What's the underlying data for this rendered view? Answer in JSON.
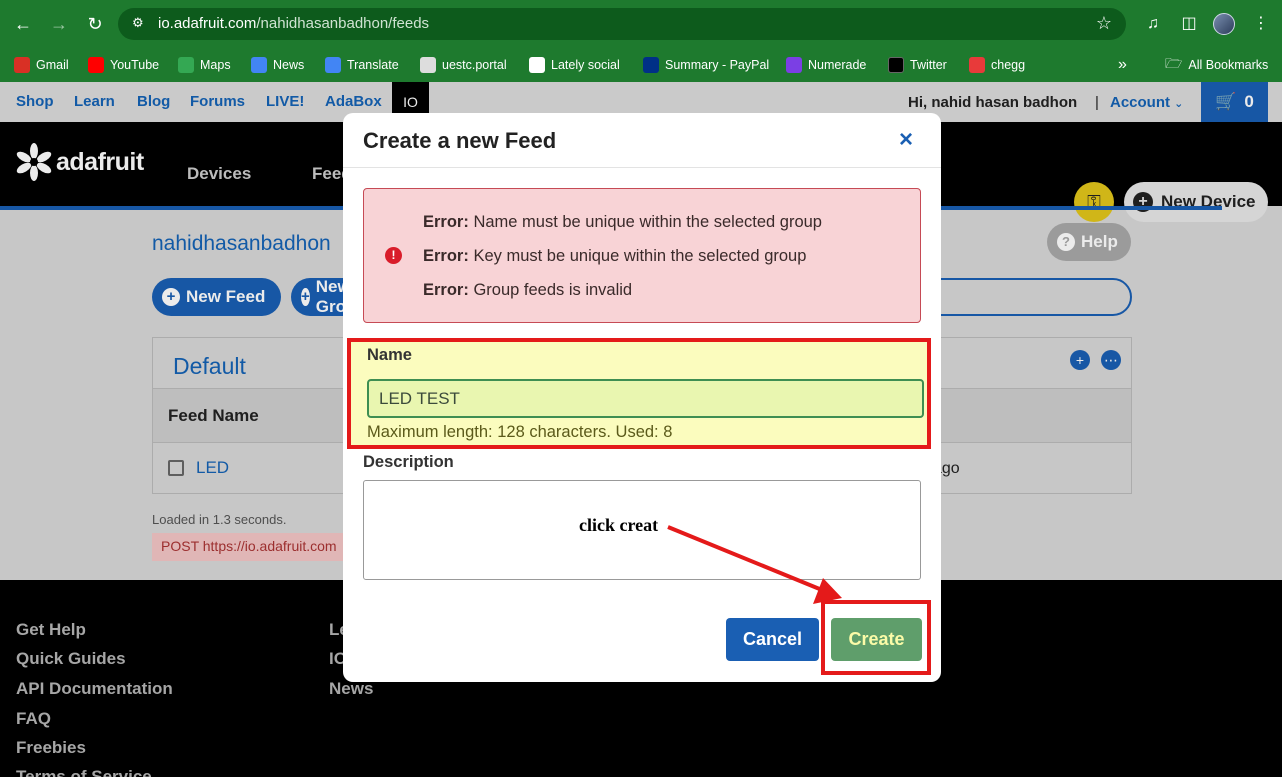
{
  "browser": {
    "url_domain": "io.adafruit.com",
    "url_path": "/nahidhasanbadhon/feeds",
    "more_label": "»",
    "all_bookmarks": "All Bookmarks",
    "bookmarks": [
      {
        "label": "Gmail",
        "color": "#d93025"
      },
      {
        "label": "YouTube",
        "color": "#ff0000"
      },
      {
        "label": "Maps",
        "color": "#34a853"
      },
      {
        "label": "News",
        "color": "#4285f4"
      },
      {
        "label": "Translate",
        "color": "#4285f4"
      },
      {
        "label": "uestc.portal",
        "color": "#dddddd"
      },
      {
        "label": "Lately social",
        "color": "#ffffff"
      },
      {
        "label": "Summary - PayPal",
        "color": "#003087"
      },
      {
        "label": "Numerade",
        "color": "#7b3fe4"
      },
      {
        "label": "Twitter",
        "color": "#000000"
      },
      {
        "label": "chegg",
        "color": "#e83a3a"
      }
    ]
  },
  "topbar": {
    "links": [
      "Shop",
      "Learn",
      "Blog",
      "Forums",
      "LIVE!",
      "AdaBox"
    ],
    "io": "IO",
    "greeting": "Hi, nahid hasan badhon",
    "separator": "|",
    "account": "Account",
    "cart_count": "0"
  },
  "mainnav": {
    "logo": "adafruit",
    "devices": "Devices",
    "feeds": "Feeds",
    "new_device": "New Device"
  },
  "content": {
    "user": "nahidhasanbadhon",
    "help": "Help",
    "new_feed": "New Feed",
    "new_group": "New Group",
    "group_title": "Default",
    "col_feed_name": "Feed Name",
    "feed_row": "LED",
    "feed_row_time": "ago",
    "loaded": "Loaded in 1.3 seconds.",
    "post": "POST https://io.adafruit.com"
  },
  "footer": {
    "col1": [
      "Get Help",
      "Quick Guides",
      "API Documentation",
      "FAQ",
      "Freebies",
      "Terms of Service"
    ],
    "col2": [
      "Le",
      "IO",
      "News"
    ]
  },
  "modal": {
    "title": "Create a new Feed",
    "close": "×",
    "errors": [
      {
        "prefix": "Error:",
        "text": "Name must be unique within the selected group"
      },
      {
        "prefix": "Error:",
        "text": "Key must be unique within the selected group"
      },
      {
        "prefix": "Error:",
        "text": "Group feeds is invalid"
      }
    ],
    "name_label": "Name",
    "name_value": "LED TEST",
    "name_hint": "Maximum length: 128 characters. Used: 8",
    "description_label": "Description",
    "description_value": "",
    "annotation": "click creat",
    "cancel": "Cancel",
    "create": "Create"
  },
  "colors": {
    "chrome_green": "#1e7a2e",
    "adafruit_blue": "#1a5fb3",
    "highlight_red": "#e41a1a",
    "create_green": "#5f9e6b"
  }
}
